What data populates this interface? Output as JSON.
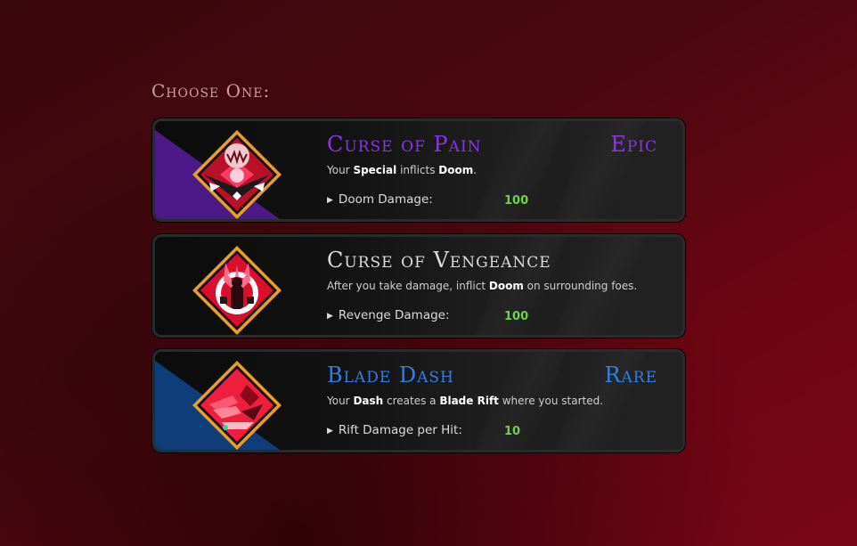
{
  "heading": "Choose One:",
  "colors": {
    "epic": "#8b35e6",
    "rare": "#2f7fe8",
    "common_title": "#dcdcdc",
    "value_green": "#6fd24a"
  },
  "boons": [
    {
      "title": "Curse of Pain",
      "rarity": "Epic",
      "rarity_color": "#8b35e6",
      "icon": "curse-of-pain-icon",
      "desc_pre": "Your ",
      "desc_b1": "Special",
      "desc_mid": " inflicts ",
      "desc_b2": "Doom",
      "desc_post": ".",
      "stat_label": "Doom Damage:",
      "stat_value": "100"
    },
    {
      "title": "Curse of Vengeance",
      "rarity": "",
      "rarity_color": "",
      "icon": "curse-of-vengeance-icon",
      "desc_pre": "After you take damage, inflict ",
      "desc_b1": "Doom",
      "desc_mid": " on surrounding foes.",
      "desc_b2": "",
      "desc_post": "",
      "stat_label": "Revenge Damage:",
      "stat_value": "100"
    },
    {
      "title": "Blade Dash",
      "rarity": "Rare",
      "rarity_color": "#2f7fe8",
      "icon": "blade-dash-icon",
      "desc_pre": "Your ",
      "desc_b1": "Dash",
      "desc_mid": " creates a ",
      "desc_b2": "Blade Rift",
      "desc_post": " where you started.",
      "stat_label": "Rift Damage per Hit:",
      "stat_value": "10"
    }
  ]
}
